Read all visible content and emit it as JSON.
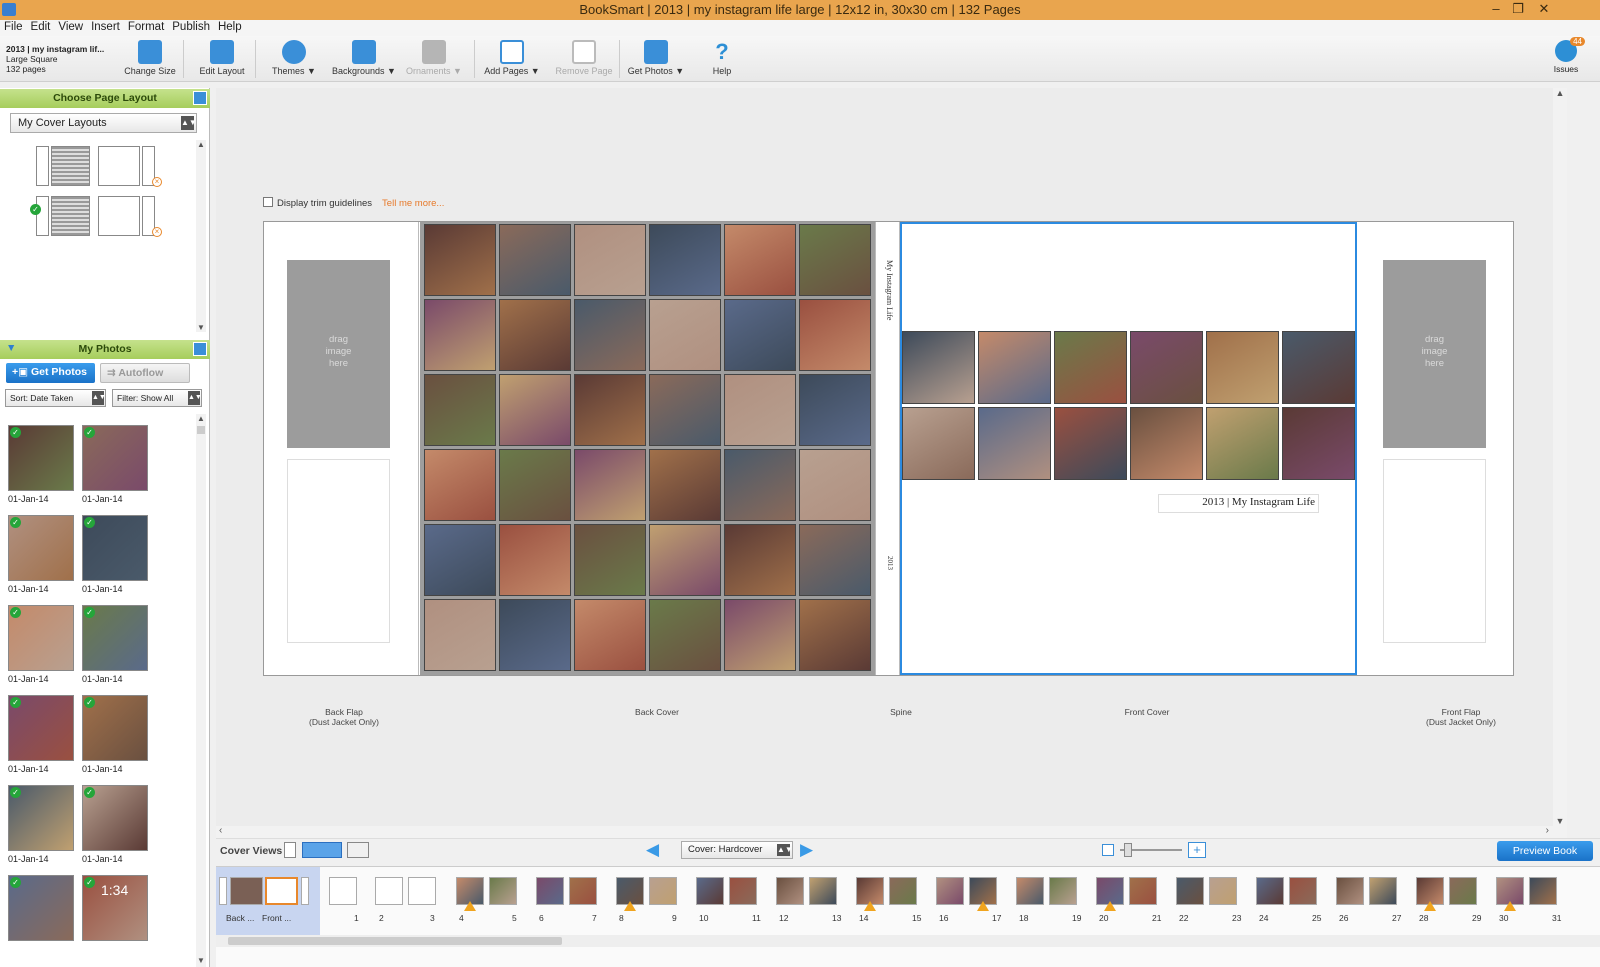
{
  "window": {
    "title": "BookSmart  |  2013 | my instagram life large  |  12x12 in, 30x30 cm  |  132 Pages",
    "controls": [
      "–",
      "❐",
      "✕"
    ]
  },
  "menu": [
    "File",
    "Edit",
    "View",
    "Insert",
    "Format",
    "Publish",
    "Help"
  ],
  "book_info": {
    "title": "2013 | my instagram lif...",
    "size": "Large Square",
    "pages": "132 pages"
  },
  "toolbar": {
    "change_size": "Change Size",
    "edit_layout": "Edit Layout",
    "themes": "Themes ▼",
    "backgrounds": "Backgrounds ▼",
    "ornaments": "Ornaments ▼",
    "add_pages": "Add Pages ▼",
    "remove_page": "Remove Page",
    "get_photos": "Get Photos ▼",
    "help": "Help",
    "issues": "Issues",
    "issues_count": "44"
  },
  "layout_panel": {
    "header": "Choose Page Layout",
    "dropdown": "My Cover Layouts"
  },
  "photos_panel": {
    "header": "My Photos",
    "get_photos": "Get Photos",
    "autoflow": "Autoflow",
    "sort": "Sort:  Date Taken",
    "filter": "Filter:  Show All",
    "photo_date": "01-Jan-14",
    "clock_text": "1:34"
  },
  "canvas": {
    "trim_label": "Display trim guidelines",
    "tell_me": "Tell me more...",
    "drag_image": "drag\nimage\nhere",
    "spine_title": "My Instagram Life",
    "spine_year": "2013",
    "front_title": "2013 | My Instagram Life",
    "labels": {
      "back_flap": "Back Flap\n(Dust Jacket Only)",
      "back_cover": "Back Cover",
      "spine": "Spine",
      "front_cover": "Front Cover",
      "front_flap": "Front Flap\n(Dust Jacket Only)"
    }
  },
  "coverbar": {
    "cover_views": "Cover Views",
    "cover_type": "Cover: Hardcover",
    "preview": "Preview Book"
  },
  "filmstrip": {
    "cover_labels": [
      "Back ...",
      "Front ..."
    ],
    "pages": [
      "1",
      "2",
      "3",
      "4",
      "5",
      "6",
      "7",
      "8",
      "9",
      "10",
      "11",
      "12",
      "13",
      "14",
      "15",
      "16",
      "17",
      "18",
      "19",
      "20",
      "21",
      "22",
      "23",
      "24",
      "25",
      "26",
      "27",
      "28",
      "29",
      "30",
      "31"
    ]
  },
  "colors": {
    "titlebar": "#e9a54e",
    "accent_blue": "#2d8fd5",
    "panel_green": "#a6cd5c",
    "warning": "#f0a41e",
    "link_orange": "#e77a2b"
  }
}
